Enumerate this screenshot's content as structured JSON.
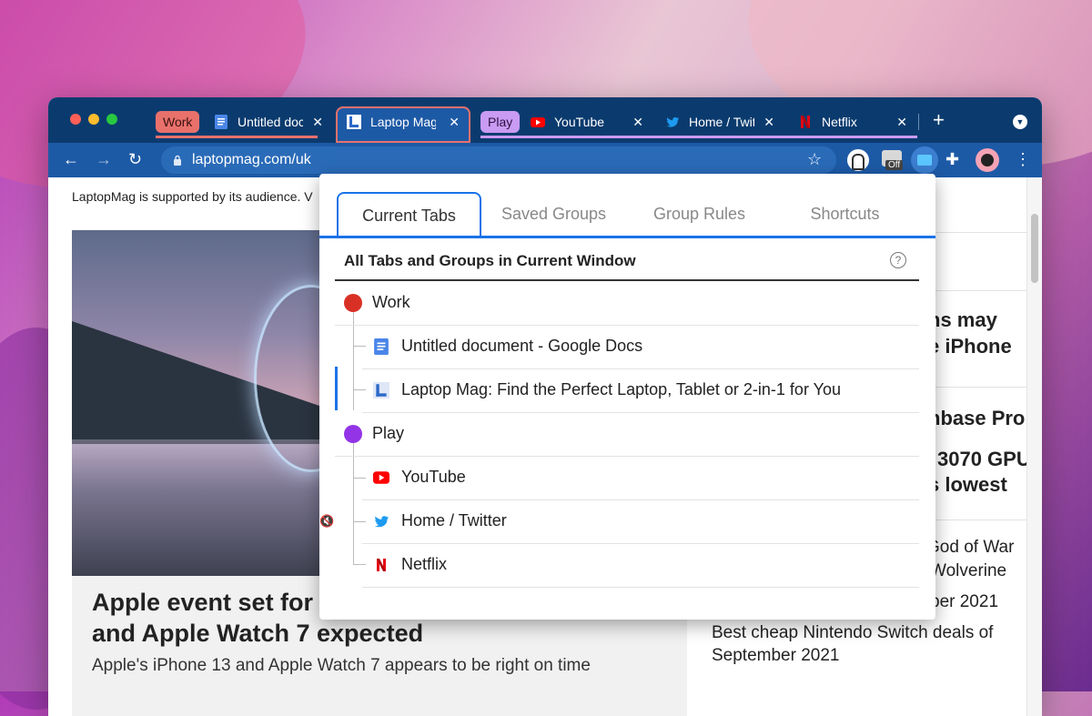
{
  "browser": {
    "tabs": [
      {
        "group": "Work",
        "title": "Untitled document",
        "favicon": "google-docs-icon"
      },
      {
        "group": "Work",
        "title": "Laptop Mag",
        "favicon": "laptopmag-icon",
        "active": true
      },
      {
        "group": "Play",
        "title": "YouTube",
        "favicon": "youtube-icon"
      },
      {
        "group": "Play",
        "title": "Home / Twitter",
        "favicon": "twitter-icon"
      },
      {
        "group": "Play",
        "title": "Netflix",
        "favicon": "netflix-icon"
      }
    ],
    "groups": {
      "work": "Work",
      "play": "Play"
    },
    "address": "laptopmag.com/uk",
    "extension_badge": "Off",
    "colors": {
      "tabbar": "#0b3b6e",
      "toolbar": "#1d5aa6",
      "work": "#e8716b",
      "play": "#c99bf2",
      "accent": "#1a73e8"
    }
  },
  "page": {
    "support_text": "LaptopMag is supported by its audience. V",
    "headline": "Apple event set for\nand Apple Watch 7 expected",
    "headline_l1": "Apple event set for",
    "headline_l2": "and Apple Watch 7 expected",
    "subhead": "Apple's iPhone 13 and Apple Watch 7 appears to be right on time",
    "sidebar": {
      "s1": "ns may",
      "s2": "e iPhone",
      "s3": "nbase Pro",
      "s4": "3070 GPU",
      "s5": "s lowest",
      "s6": "God of War",
      "s7": "Wolverine",
      "s8": "ber 2021",
      "s9": "Best cheap Nintendo Switch deals of",
      "s10": "September 2021"
    }
  },
  "popup": {
    "tabs": [
      "Current Tabs",
      "Saved Groups",
      "Group Rules",
      "Shortcuts"
    ],
    "section_title": "All Tabs and Groups in Current Window",
    "help": "?",
    "rows": {
      "work": "Work",
      "docs": "Untitled document - Google Docs",
      "laptopmag": "Laptop Mag: Find the Perfect Laptop, Tablet or 2-in-1 for You",
      "play": "Play",
      "youtube": "YouTube",
      "twitter": "Home / Twitter",
      "netflix": "Netflix"
    }
  }
}
